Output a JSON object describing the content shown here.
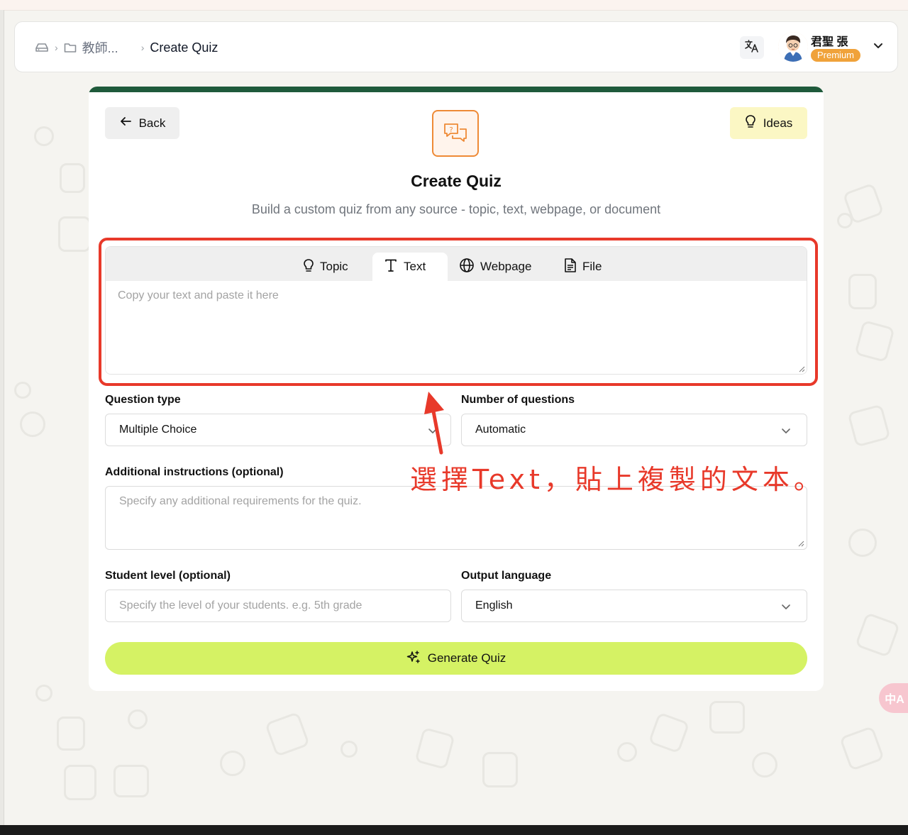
{
  "breadcrumb": {
    "folder_label": "教師...",
    "current": "Create Quiz"
  },
  "user": {
    "name": "君聖 張",
    "badge": "Premium"
  },
  "icons": {
    "home": "drive-icon",
    "folder": "folder-icon",
    "translate": "translate-icon",
    "back": "arrow-left-icon",
    "ideas": "lightbulb-icon",
    "hero": "chat-question-icon",
    "generate": "sparkles-icon"
  },
  "card": {
    "back_label": "Back",
    "ideas_label": "Ideas",
    "title": "Create Quiz",
    "subtitle": "Build a custom quiz from any source - topic, text, webpage, or document",
    "accent_color": "#1f5a3b"
  },
  "source": {
    "tabs": [
      {
        "label": "Topic",
        "icon": "lightbulb-icon",
        "active": false
      },
      {
        "label": "Text",
        "icon": "text-icon",
        "active": true
      },
      {
        "label": "Webpage",
        "icon": "globe-icon",
        "active": false
      },
      {
        "label": "File",
        "icon": "document-icon",
        "active": false
      }
    ],
    "placeholder": "Copy your text and paste it here",
    "value": ""
  },
  "form": {
    "question_type_label": "Question type",
    "question_type_value": "Multiple Choice",
    "num_questions_label": "Number of questions",
    "num_questions_value": "Automatic",
    "instructions_label": "Additional instructions (optional)",
    "instructions_placeholder": "Specify any additional requirements for the quiz.",
    "student_level_label": "Student level (optional)",
    "student_level_placeholder": "Specify the level of your students. e.g. 5th grade",
    "output_language_label": "Output language",
    "output_language_value": "English",
    "generate_label": "Generate Quiz",
    "generate_color": "#d5f264"
  },
  "annotation": {
    "text": "選擇Text，貼上複製的文本。",
    "color": "#e8392a"
  },
  "floating": {
    "translate_label": "中A"
  }
}
